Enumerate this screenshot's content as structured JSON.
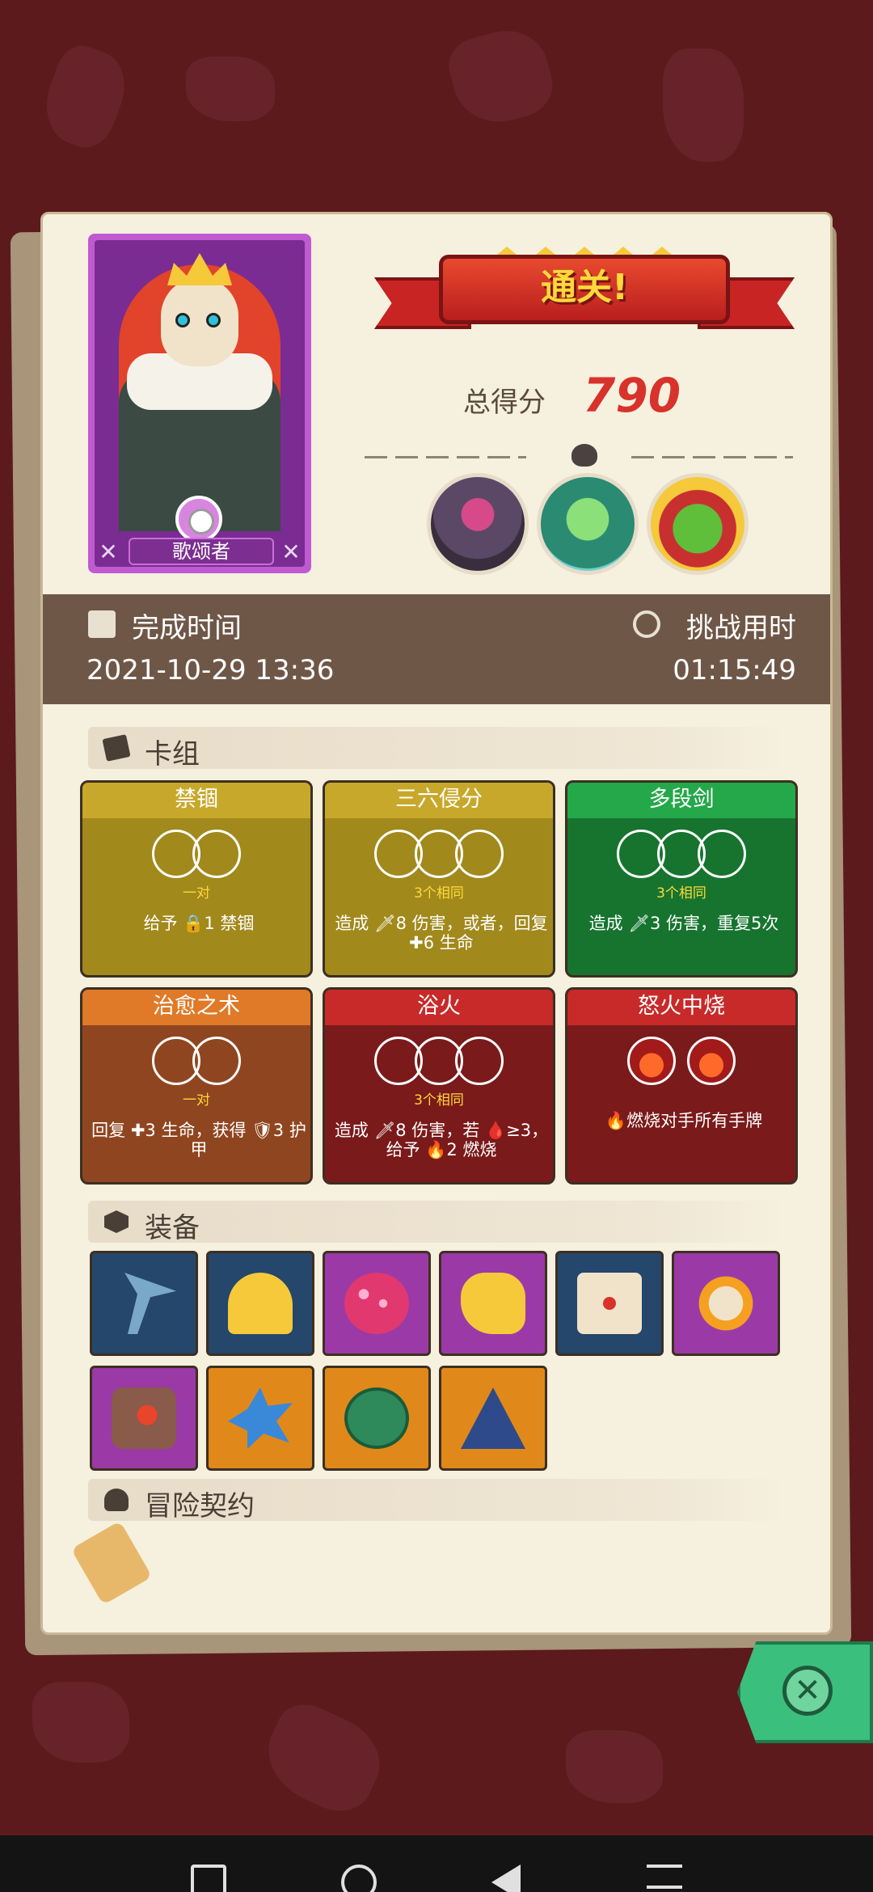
{
  "hero": {
    "class_name": "歌颂者"
  },
  "result": {
    "title": "通关!",
    "score_label": "总得分",
    "score_value": "790"
  },
  "time_panel": {
    "finish_label": "完成时间",
    "finish_value": "2021-10-29 13:36",
    "challenge_label": "挑战用时",
    "challenge_value": "01:15:49"
  },
  "deck": {
    "header": "卡组",
    "cards": [
      {
        "title": "禁锢",
        "sub": "一对",
        "desc": "给予 🔒1 禁锢",
        "color": "#b8a020"
      },
      {
        "title": "三六侵分",
        "sub": "3个相同",
        "desc": "造成 🗡8 伤害，或者，回复 ✚6 生命",
        "color": "#b8a020"
      },
      {
        "title": "多段剑",
        "sub": "3个相同",
        "desc": "造成 🗡3 伤害，重复5次",
        "color": "#1e8a3c"
      },
      {
        "title": "治愈之术",
        "sub": "一对",
        "desc": "回复 ✚3 生命，获得 🛡3 护甲",
        "color": "#b5522a"
      },
      {
        "title": "浴火",
        "sub": "3个相同",
        "desc": "造成 🗡8 伤害，若 🩸≥3，给予 🔥2 燃烧",
        "color": "#8e1d1d"
      },
      {
        "title": "怒火中烧",
        "sub": "",
        "desc": "🔥燃烧对手所有手牌",
        "color": "#8e1d1d"
      }
    ]
  },
  "equipment": {
    "header": "装备",
    "items": [
      {
        "name": "scythe-icon",
        "bg": "#24476b"
      },
      {
        "name": "golden-helmet-icon",
        "bg": "#24476b"
      },
      {
        "name": "spotted-shell-icon",
        "bg": "#9b3aa6"
      },
      {
        "name": "golden-glove-icon",
        "bg": "#9b3aa6"
      },
      {
        "name": "fire-scroll-icon",
        "bg": "#24476b"
      },
      {
        "name": "sun-mask-icon",
        "bg": "#9b3aa6"
      },
      {
        "name": "fire-stone-icon",
        "bg": "#9b3aa6"
      },
      {
        "name": "spiked-ice-icon",
        "bg": "#e0891a"
      },
      {
        "name": "turtle-shell-icon",
        "bg": "#e0891a"
      },
      {
        "name": "hexagram-icon",
        "bg": "#e0891a"
      }
    ]
  },
  "contract": {
    "header": "冒险契约"
  }
}
